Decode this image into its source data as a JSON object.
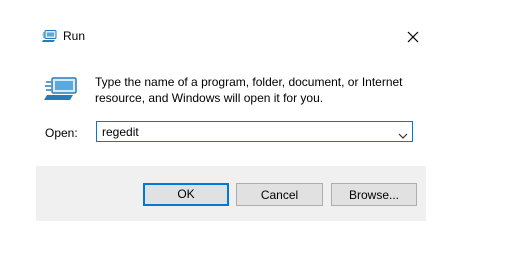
{
  "window": {
    "title": "Run",
    "icon": "run-app-icon",
    "close_icon": "close-icon"
  },
  "content": {
    "icon": "run-app-icon",
    "description": "Type the name of a program, folder, document, or Internet resource, and Windows will open it for you."
  },
  "open_field": {
    "label": "Open:",
    "value": "regedit",
    "dropdown_icon": "chevron-down-icon"
  },
  "buttons": {
    "ok": "OK",
    "cancel": "Cancel",
    "browse": "Browse..."
  },
  "colors": {
    "accent": "#0078d7",
    "footer_bg": "#f0f0f0",
    "button_bg": "#e1e1e1",
    "button_border": "#adadad"
  }
}
